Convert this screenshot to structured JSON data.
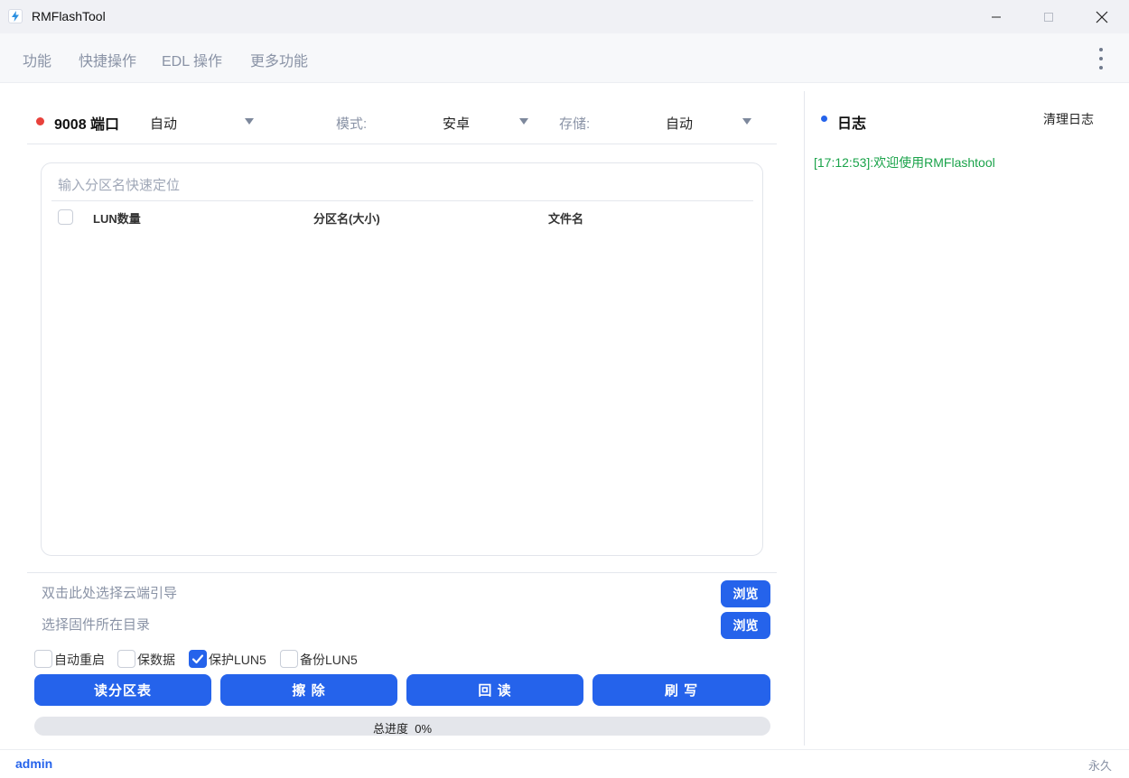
{
  "window": {
    "title": "RMFlashTool"
  },
  "menu": {
    "items": [
      "功能",
      "快捷操作",
      "EDL 操作",
      "更多功能"
    ]
  },
  "device": {
    "port_label": "9008 端口",
    "port_select": "自动",
    "mode_label": "模式:",
    "mode_select": "安卓",
    "storage_label": "存储:",
    "storage_select": "自动",
    "status_color": "#e8413b"
  },
  "partition_table": {
    "search_placeholder": "输入分区名快速定位",
    "columns": [
      "LUN数量",
      "分区名(大小)",
      "文件名"
    ],
    "rows": []
  },
  "paths": {
    "cloud_placeholder": "双击此处选择云端引导",
    "firmware_placeholder": "选择固件所在目录",
    "browse_label": "浏览"
  },
  "options": [
    {
      "label": "自动重启",
      "checked": false
    },
    {
      "label": "保数据",
      "checked": false
    },
    {
      "label": "保护LUN5",
      "checked": true
    },
    {
      "label": "备份LUN5",
      "checked": false
    }
  ],
  "actions": {
    "read_partition": "读分区表",
    "erase": "擦 除",
    "readback": "回 读",
    "flash": "刷 写"
  },
  "progress": {
    "label": "总进度",
    "value_text": "0%",
    "value": 0
  },
  "log": {
    "title": "日志",
    "clear_label": "清理日志",
    "entries": [
      "[17:12:53]:欢迎使用RMFlashtool"
    ]
  },
  "status": {
    "user": "admin",
    "license": "永久"
  },
  "colors": {
    "accent": "#2563eb",
    "log_text": "#1aa34a",
    "port_status": "#e8413b"
  }
}
